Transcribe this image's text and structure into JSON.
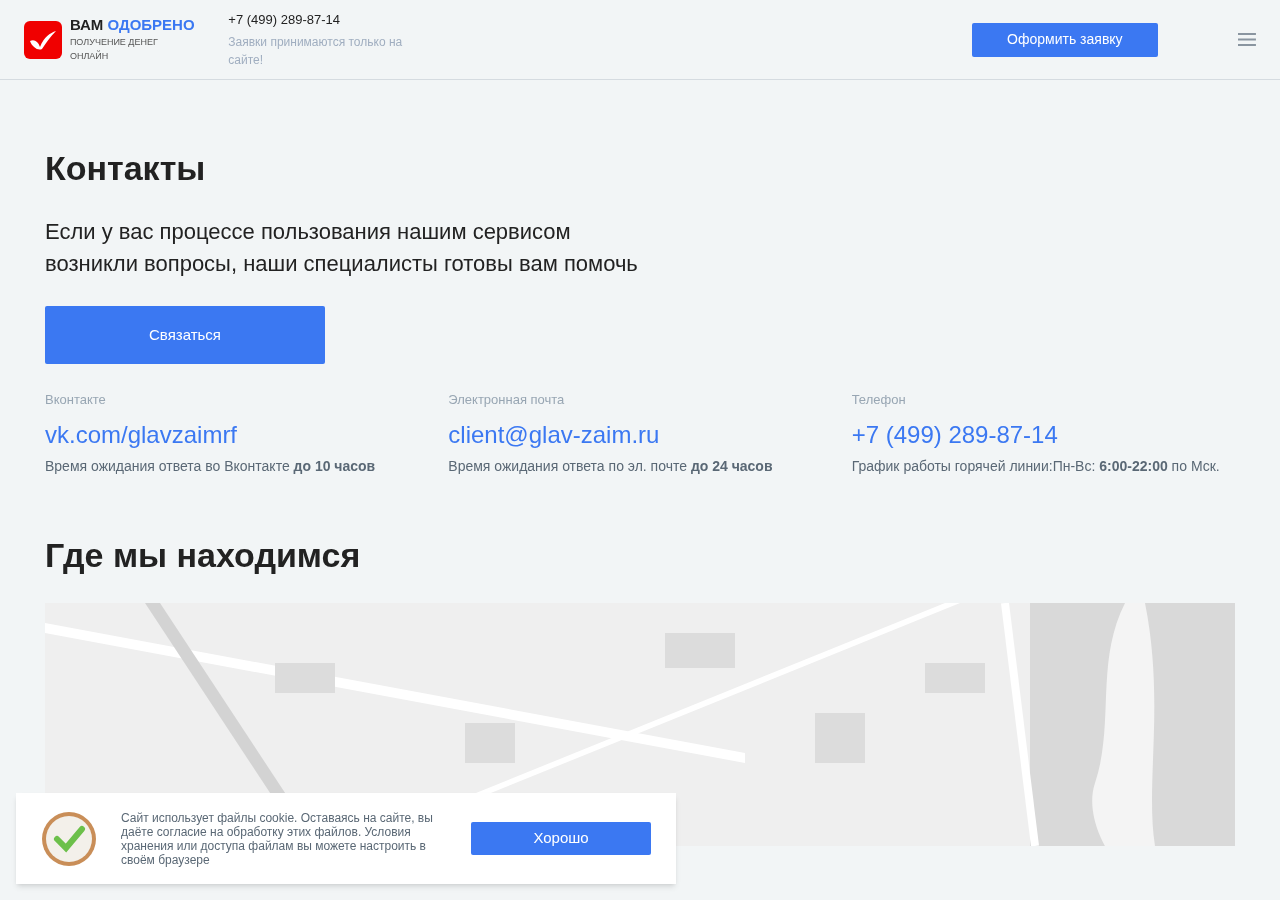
{
  "header": {
    "brand_first": "ВАМ",
    "brand_second": "ОДОБРЕНО",
    "tagline": "ПОЛУЧЕНИЕ ДЕНЕГ ОНЛАЙН",
    "phone": "+7 (499) 289-87-14",
    "note": "Заявки принимаются только на сайте!",
    "cta": "Оформить заявку"
  },
  "contacts": {
    "title": "Контакты",
    "lead": "Если у вас процессе пользования нашим сервисом возникли вопросы, наши специалисты готовы вам помочь",
    "button": "Связаться",
    "items": [
      {
        "label": "Вконтакте",
        "link": "vk.com/glavzaimrf",
        "info": "Время ожидания ответа во Вконтакте **до 10 часов**"
      },
      {
        "label": "Электронная почта",
        "link": "client@glav-zaim.ru",
        "info": "Время ожидания ответа по эл. почте **до 24 часов**"
      },
      {
        "label": "Телефон",
        "link": "+7 (499) 289-87-14",
        "info": "График работы горячей линии:Пн-Вс: **6:00-22:00** по Мск."
      }
    ]
  },
  "location": {
    "title": "Где мы находимся"
  },
  "cookie": {
    "text": "Сайт использует файлы cookie. Оставаясь на сайте, вы даёте согласие на обработку этих файлов. Условия хранения или доступа файлам вы можете настроить в своём браузере",
    "button": "Хорошо"
  }
}
